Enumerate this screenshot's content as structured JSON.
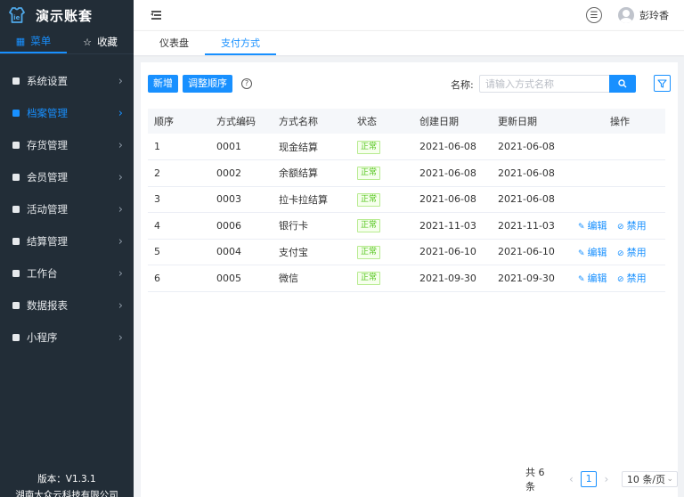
{
  "app": {
    "title": "演示账套"
  },
  "side_tabs": [
    {
      "label": "菜单",
      "icon": "grid-icon"
    },
    {
      "label": "收藏",
      "icon": "star-icon"
    }
  ],
  "menu": [
    {
      "label": "系统设置",
      "active": false
    },
    {
      "label": "档案管理",
      "active": true
    },
    {
      "label": "存货管理",
      "active": false
    },
    {
      "label": "会员管理",
      "active": false
    },
    {
      "label": "活动管理",
      "active": false
    },
    {
      "label": "结算管理",
      "active": false
    },
    {
      "label": "工作台",
      "active": false
    },
    {
      "label": "数据报表",
      "active": false
    },
    {
      "label": "小程序",
      "active": false
    }
  ],
  "footer": {
    "version": "版本：V1.3.1",
    "company": "湖南大众云科技有限公司"
  },
  "header": {
    "user": "彭玲香"
  },
  "page_tabs": [
    {
      "label": "仪表盘",
      "active": false
    },
    {
      "label": "支付方式",
      "active": true
    }
  ],
  "toolbar": {
    "add_label": "新增",
    "reorder_label": "调整顺序",
    "name_label": "名称:",
    "search_placeholder": "请输入方式名称"
  },
  "table": {
    "columns": [
      "顺序",
      "方式编码",
      "方式名称",
      "状态",
      "创建日期",
      "更新日期",
      "操作"
    ],
    "rows": [
      {
        "order": "1",
        "code": "0001",
        "name": "现金结算",
        "status": "正常",
        "created": "2021-06-08",
        "updated": "2021-06-08",
        "ops": []
      },
      {
        "order": "2",
        "code": "0002",
        "name": "余额结算",
        "status": "正常",
        "created": "2021-06-08",
        "updated": "2021-06-08",
        "ops": []
      },
      {
        "order": "3",
        "code": "0003",
        "name": "拉卡拉结算",
        "status": "正常",
        "created": "2021-06-08",
        "updated": "2021-06-08",
        "ops": []
      },
      {
        "order": "4",
        "code": "0006",
        "name": "银行卡",
        "status": "正常",
        "created": "2021-11-03",
        "updated": "2021-11-03",
        "ops": [
          "编辑",
          "禁用"
        ]
      },
      {
        "order": "5",
        "code": "0004",
        "name": "支付宝",
        "status": "正常",
        "created": "2021-06-10",
        "updated": "2021-06-10",
        "ops": [
          "编辑",
          "禁用"
        ]
      },
      {
        "order": "6",
        "code": "0005",
        "name": "微信",
        "status": "正常",
        "created": "2021-09-30",
        "updated": "2021-09-30",
        "ops": [
          "编辑",
          "禁用"
        ]
      }
    ]
  },
  "pagination": {
    "total": "共 6 条",
    "current": "1",
    "page_size": "10 条/页"
  },
  "colors": {
    "accent": "#1890ff",
    "sidebar_bg": "#222d37",
    "status_green": "#52c41a"
  }
}
